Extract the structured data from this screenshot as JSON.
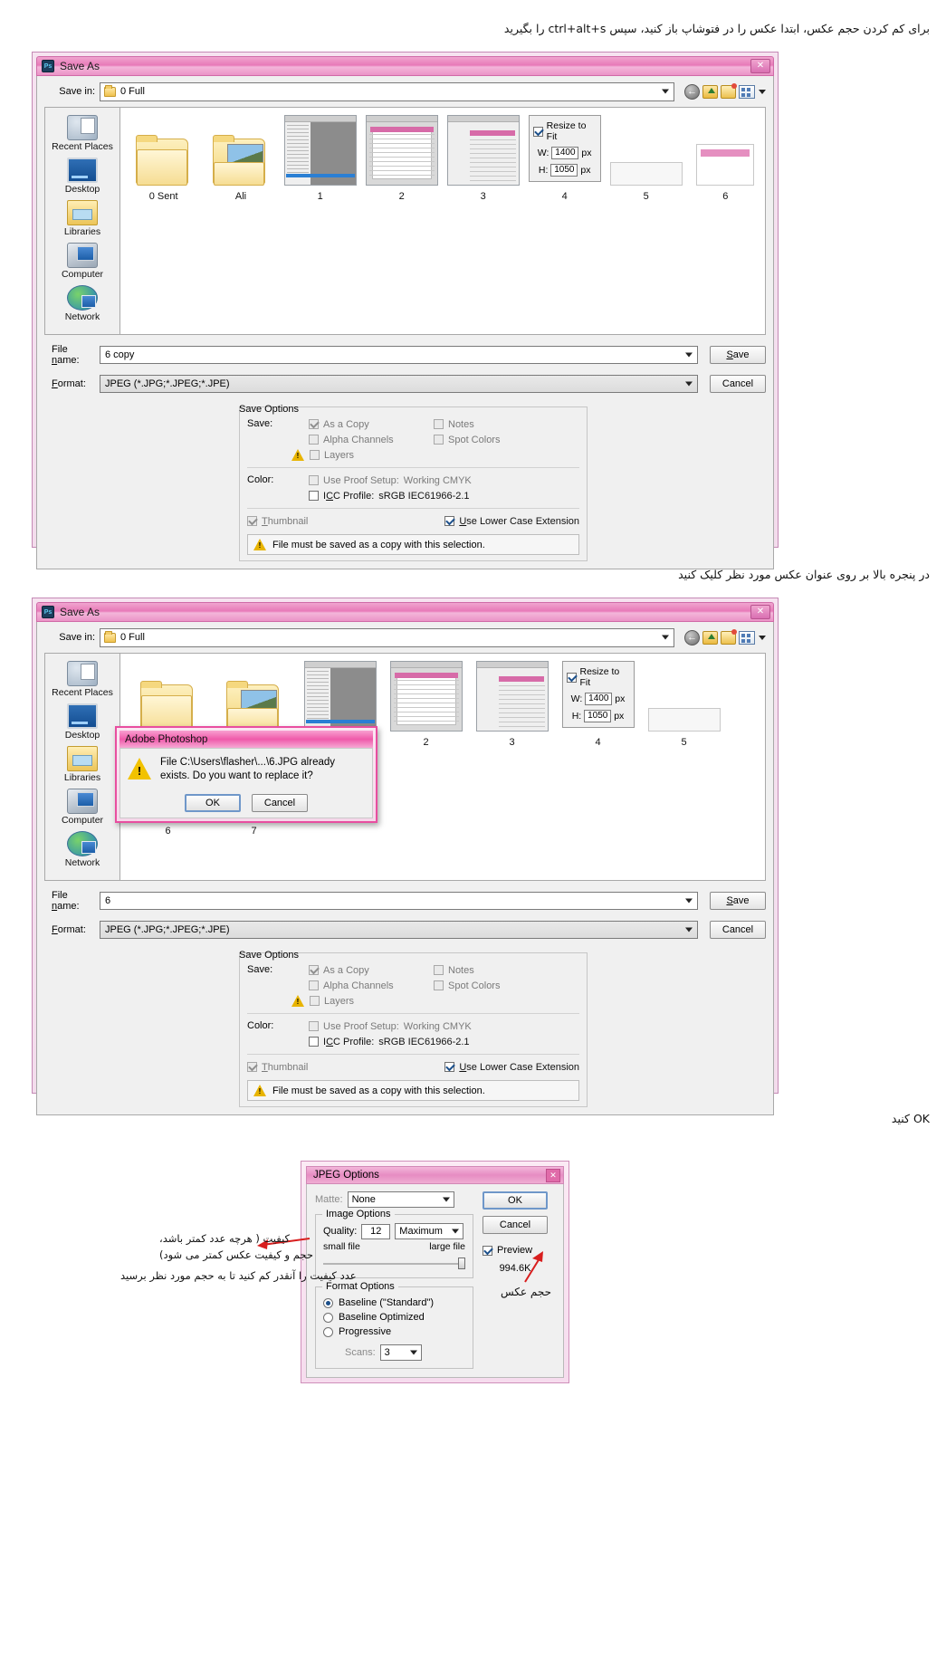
{
  "annotations": {
    "step1": "برای کم کردن حجم عکس، ابتدا عکس را در فتوشاپ باز کنید، سپس ctrl+alt+s را بگیرید",
    "step2": "در پنجره بالا بر روی عنوان عکس مورد نظر کلیک کنید",
    "step3": "OK کنید",
    "quality_note_l1": "کیفیت ( هرچه عدد کمتر باشد،",
    "quality_note_l2": "حجم و کیفیت عکس کمتر می شود)",
    "quality_note_l3": "عدد کیفیت را آنقدر کم کنید تا به حجم مورد نظر برسید",
    "filesize_note": "حجم عکس"
  },
  "saveas1": {
    "title": "Save As",
    "close_label": "✕",
    "save_in_label": "Save in:",
    "save_in_value": "0 Full",
    "toolbar": {
      "back": "back-icon",
      "up": "up-one-level-icon",
      "new_folder": "new-folder-icon",
      "views": "views-icon"
    },
    "places": [
      {
        "label": "Recent Places",
        "icon": "recent-places-icon"
      },
      {
        "label": "Desktop",
        "icon": "desktop-icon"
      },
      {
        "label": "Libraries",
        "icon": "libraries-icon"
      },
      {
        "label": "Computer",
        "icon": "computer-icon"
      },
      {
        "label": "Network",
        "icon": "network-icon"
      }
    ],
    "items": [
      {
        "label": "0 Sent",
        "kind": "folder"
      },
      {
        "label": "Ali",
        "kind": "folder-photo"
      },
      {
        "label": "1",
        "kind": "screenshot-a"
      },
      {
        "label": "2",
        "kind": "screenshot-b"
      },
      {
        "label": "3",
        "kind": "screenshot-c"
      },
      {
        "label": "4",
        "kind": "resize-panel"
      },
      {
        "label": "5",
        "kind": "blank-wide"
      },
      {
        "label": "6",
        "kind": "blank-doc"
      }
    ],
    "resize_panel": {
      "resize_to_fit_label": "Resize to Fit",
      "resize_to_fit_checked": true,
      "w_label": "W:",
      "w_value": "1400",
      "w_unit": "px",
      "h_label": "H:",
      "h_value": "1050",
      "h_unit": "px"
    },
    "file_name_label": "File name:",
    "file_name_value": "6 copy",
    "format_label": "Format:",
    "format_value": "JPEG (*.JPG;*.JPEG;*.JPE)",
    "save_button": "Save",
    "cancel_button": "Cancel",
    "save_options": {
      "group_title": "Save Options",
      "save_label": "Save:",
      "as_a_copy": {
        "label": "As a Copy",
        "checked": true,
        "enabled": false
      },
      "notes": {
        "label": "Notes",
        "checked": false,
        "enabled": false
      },
      "alpha_channels": {
        "label": "Alpha Channels",
        "checked": false,
        "enabled": false
      },
      "spot_colors": {
        "label": "Spot Colors",
        "checked": false,
        "enabled": false
      },
      "layers": {
        "label": "Layers",
        "checked": false,
        "enabled": false
      },
      "color_label": "Color:",
      "use_proof_setup": {
        "label": "Use Proof Setup:",
        "value": "Working CMYK",
        "checked": false
      },
      "icc_profile": {
        "label": "ICC Profile:",
        "value": "sRGB IEC61966-2.1",
        "checked": false
      },
      "thumbnail": {
        "label": "Thumbnail",
        "checked": true,
        "enabled": false
      },
      "use_lower_case_extension": {
        "label": "Use Lower Case Extension",
        "checked": true
      },
      "warning_text": "File must be saved as a copy with this selection."
    }
  },
  "saveas2": {
    "title": "Save As",
    "close_label": "✕",
    "save_in_label": "Save in:",
    "save_in_value": "0 Full",
    "places": [
      {
        "label": "Recent Places",
        "icon": "recent-places-icon"
      },
      {
        "label": "Desktop",
        "icon": "desktop-icon"
      },
      {
        "label": "Libraries",
        "icon": "libraries-icon"
      },
      {
        "label": "Computer",
        "icon": "computer-icon"
      },
      {
        "label": "Network",
        "icon": "network-icon"
      }
    ],
    "items": [
      {
        "label": "",
        "kind": "folder"
      },
      {
        "label": "",
        "kind": "folder-photo"
      },
      {
        "label": "",
        "kind": "screenshot-a"
      },
      {
        "label": "2",
        "kind": "screenshot-b"
      },
      {
        "label": "3",
        "kind": "screenshot-c"
      },
      {
        "label": "4",
        "kind": "resize-panel"
      },
      {
        "label": "5",
        "kind": "blank-wide"
      }
    ],
    "items_row2": [
      {
        "label": "6"
      },
      {
        "label": "7"
      }
    ],
    "resize_panel": {
      "resize_to_fit_label": "Resize to Fit",
      "resize_to_fit_checked": true,
      "w_label": "W:",
      "w_value": "1400",
      "w_unit": "px",
      "h_label": "H:",
      "h_value": "1050",
      "h_unit": "px"
    },
    "file_name_label": "File name:",
    "file_name_value": "6",
    "format_label": "Format:",
    "format_value": "JPEG (*.JPG;*.JPEG;*.JPE)",
    "save_button": "Save",
    "cancel_button": "Cancel",
    "save_options": {
      "group_title": "Save Options",
      "save_label": "Save:",
      "as_a_copy": {
        "label": "As a Copy"
      },
      "notes": {
        "label": "Notes"
      },
      "alpha_channels": {
        "label": "Alpha Channels"
      },
      "spot_colors": {
        "label": "Spot Colors"
      },
      "layers": {
        "label": "Layers"
      },
      "color_label": "Color:",
      "use_proof_setup": {
        "label": "Use Proof Setup:",
        "value": "Working CMYK"
      },
      "icc_profile": {
        "label": "ICC Profile:",
        "value": "sRGB IEC61966-2.1"
      },
      "thumbnail": {
        "label": "Thumbnail"
      },
      "use_lower_case_extension": {
        "label": "Use Lower Case Extension"
      },
      "warning_text": "File must be saved as a copy with this selection."
    }
  },
  "alert": {
    "title": "Adobe Photoshop",
    "message": "File C:\\Users\\flasher\\...\\6.JPG already exists.  Do you want to replace it?",
    "ok_button": "OK",
    "cancel_button": "Cancel"
  },
  "jpeg_options": {
    "title": "JPEG Options",
    "close_label": "✕",
    "matte_label": "Matte:",
    "matte_value": "None",
    "image_options_title": "Image Options",
    "quality_label": "Quality:",
    "quality_value": "12",
    "quality_preset": "Maximum",
    "small_file_label": "small file",
    "large_file_label": "large file",
    "format_options_title": "Format Options",
    "baseline_standard": {
      "label": "Baseline (\"Standard\")",
      "selected": true
    },
    "baseline_optimized": {
      "label": "Baseline Optimized",
      "selected": false
    },
    "progressive": {
      "label": "Progressive",
      "selected": false
    },
    "scans_label": "Scans:",
    "scans_value": "3",
    "ok_button": "OK",
    "cancel_button": "Cancel",
    "preview_label": "Preview",
    "preview_checked": true,
    "file_size": "994.6K"
  },
  "colors": {
    "pink_title": "#ef5aaa",
    "pink_border": "#c489b5",
    "warning_yellow": "#f2c200",
    "accent_red": "#d81e1e"
  }
}
